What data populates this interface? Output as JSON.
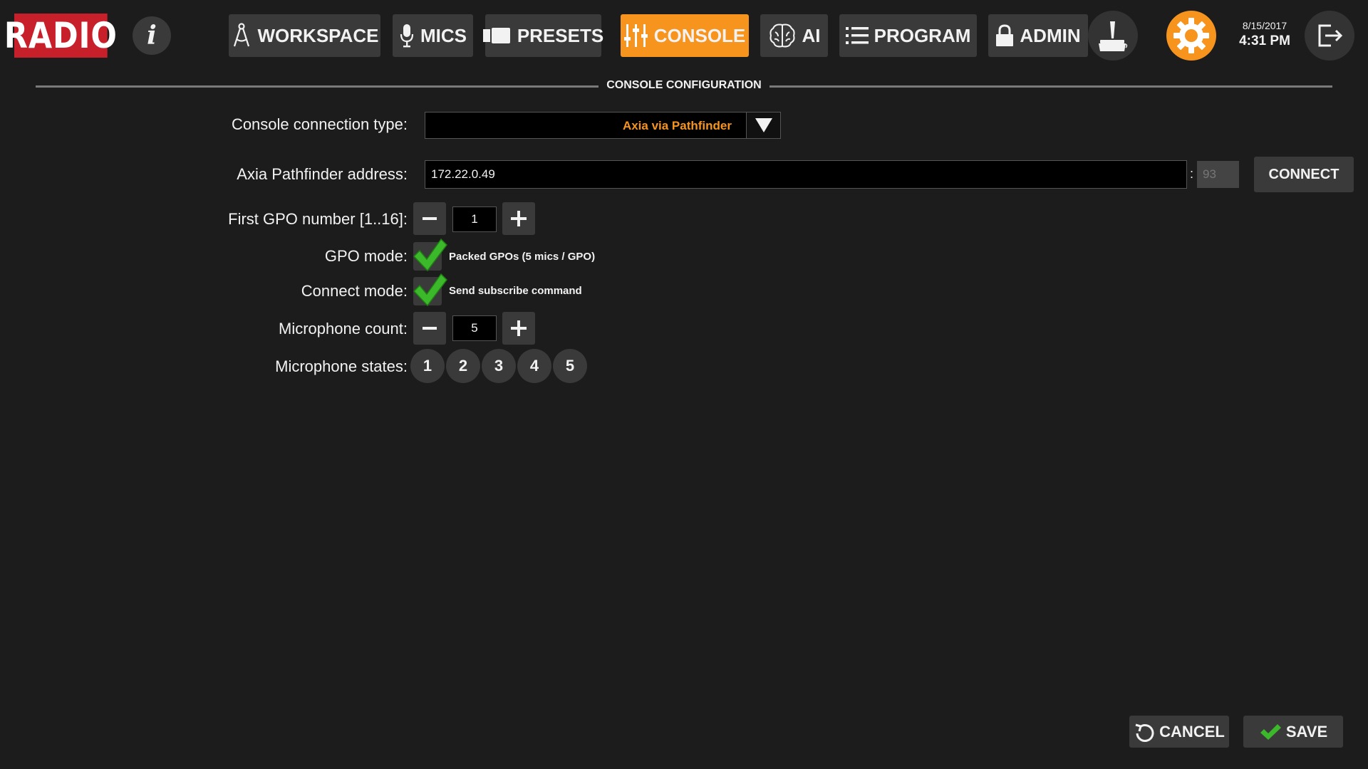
{
  "header": {
    "logo": "RADIO",
    "info_glyph": "i",
    "nav": [
      {
        "label": "WORKSPACE",
        "icon": "compass-icon"
      },
      {
        "label": "MICS",
        "icon": "microphone-icon"
      },
      {
        "label": "PRESETS",
        "icon": "camera-icon"
      },
      {
        "label": "CONSOLE",
        "icon": "sliders-icon",
        "active": true
      },
      {
        "label": "AI",
        "icon": "brain-icon"
      },
      {
        "label": "PROGRAM",
        "icon": "list-icon"
      },
      {
        "label": "ADMIN",
        "icon": "lock-icon"
      }
    ],
    "date": "8/15/2017",
    "time": "4:31 PM"
  },
  "section": {
    "title": "CONSOLE CONFIGURATION"
  },
  "form": {
    "connection_type": {
      "label": "Console connection type:",
      "value": "Axia via Pathfinder"
    },
    "address": {
      "label": "Axia Pathfinder address:",
      "value": "172.22.0.49",
      "separator": ":",
      "port_placeholder": "93",
      "connect_label": "CONNECT"
    },
    "first_gpo": {
      "label": "First GPO number [1..16]:",
      "value": "1"
    },
    "gpo_mode": {
      "label": "GPO mode:",
      "checked": true,
      "text": "Packed GPOs (5 mics / GPO)"
    },
    "connect_mode": {
      "label": "Connect mode:",
      "checked": true,
      "text": "Send subscribe command"
    },
    "mic_count": {
      "label": "Microphone count:",
      "value": "5"
    },
    "mic_states": {
      "label": "Microphone states:",
      "items": [
        "1",
        "2",
        "3",
        "4",
        "5"
      ]
    }
  },
  "footer": {
    "cancel_label": "CANCEL",
    "save_label": "SAVE"
  },
  "colors": {
    "accent": "#f7941d",
    "logo": "#c8202b",
    "check": "#3cb92b",
    "background": "#1c1c1c"
  }
}
